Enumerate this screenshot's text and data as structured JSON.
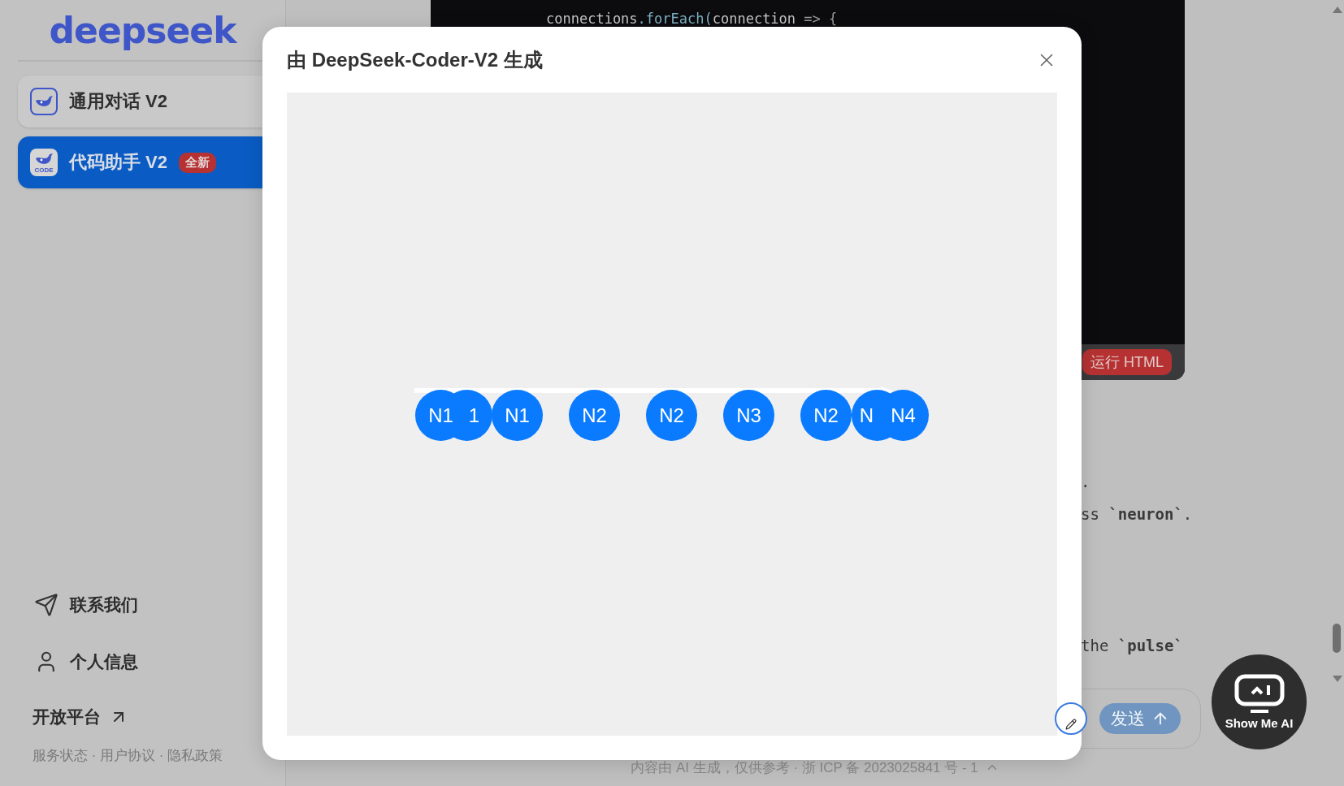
{
  "sidebar": {
    "logo": "deepseek",
    "models": [
      {
        "label": "通用对话 V2",
        "selected": false
      },
      {
        "label": "代码助手 V2",
        "selected": true,
        "icon_text": "CODE",
        "badge": "全新"
      }
    ],
    "links": [
      {
        "label": "联系我们",
        "kind": "send"
      },
      {
        "label": "个人信息",
        "kind": "user"
      }
    ],
    "platform": "开放平台",
    "footer_links": "服务状态 · 用户协议 · 隐私政策"
  },
  "main": {
    "code_line": [
      {
        "text": "connections",
        "kind": "plain"
      },
      {
        "text": ".forEach(",
        "kind": "fn"
      },
      {
        "text": "connection ",
        "kind": "plain"
      },
      {
        "text": "=> {",
        "kind": "op"
      }
    ],
    "run_button": "运行 HTML",
    "text_lines": [
      ".",
      "ss **`neuron`**.",
      "the **`pulse`**"
    ],
    "send_button": "发送",
    "footer": "内容由 AI 生成，仅供参考 · 浙 ICP 备 2023025841 号 - 1",
    "assistant_badge": "Show Me AI"
  },
  "modal": {
    "title": "由 DeepSeek-Coder-V2 生成",
    "nodes": [
      {
        "label": "N1"
      },
      {
        "label": "1"
      },
      {
        "label": "N1"
      },
      {
        "label": "N2"
      },
      {
        "label": "N2"
      },
      {
        "label": "N3"
      },
      {
        "label": "N2"
      },
      {
        "label": "N"
      },
      {
        "label": "N4"
      }
    ]
  }
}
